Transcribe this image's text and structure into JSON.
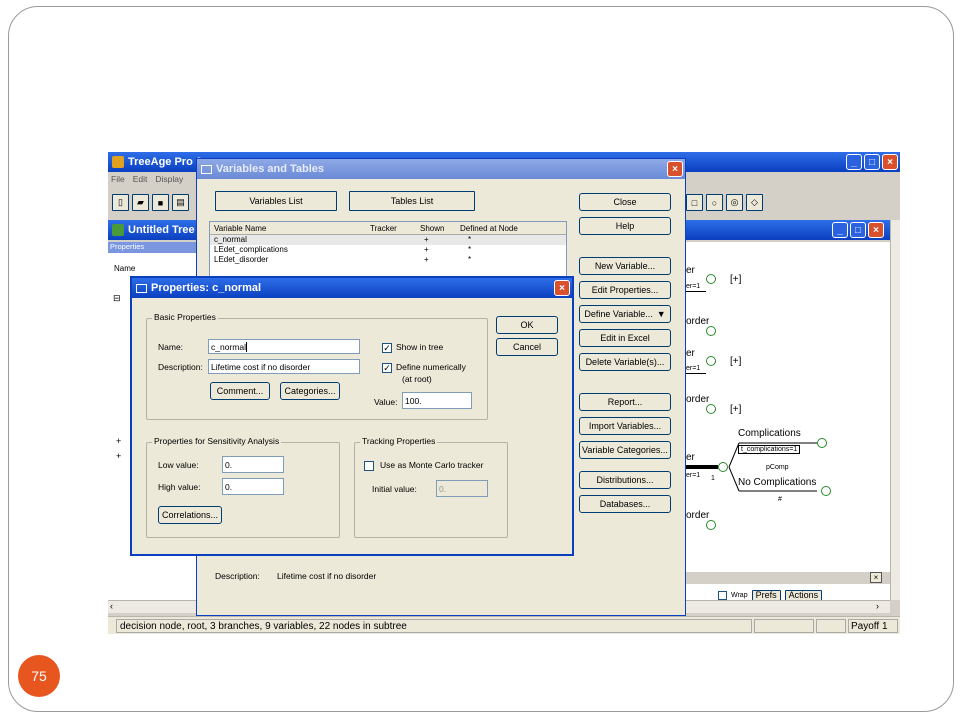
{
  "slide": {
    "page_number": "75"
  },
  "main_window": {
    "title": "TreeAge Pro 2",
    "menu": [
      "File",
      "Edit",
      "Display"
    ],
    "doc_title": "Untitled Tree",
    "properties_label": "Properties",
    "name_col": "Name",
    "status": "decision node, root, 3 branches, 9 variables, 22 nodes in subtree",
    "payoff": "Payoff 1"
  },
  "tree": {
    "labels": {
      "plus1": "[+]",
      "plus2": "[+]",
      "plus3": "[+]",
      "complications": "Complications",
      "t_complications": "t_complications=1",
      "pcomp": "pComp",
      "no_complications": "No Complications",
      "hash": "#",
      "frag_er1": "er",
      "frag_eq1": "er=1",
      "frag_order1": "order",
      "frag_er2": "er",
      "frag_eq2": "er=1",
      "frag_order2": "order",
      "frag_er3": "er",
      "frag_eq3": "er=1",
      "frag_one": "1",
      "frag_order3": "order"
    },
    "bottom_bar": {
      "wrap": "Wrap",
      "prefs": "Prefs",
      "actions": "Actions"
    }
  },
  "variables_dialog": {
    "title": "Variables and Tables",
    "tabs": [
      "Variables List",
      "Tables List"
    ],
    "columns": [
      "Variable Name",
      "Tracker",
      "Shown",
      "Defined at Node"
    ],
    "rows": [
      {
        "name": "c_normal",
        "tracker": "",
        "shown": "+",
        "defined": "*"
      },
      {
        "name": "LEdet_complications",
        "tracker": "",
        "shown": "+",
        "defined": "*"
      },
      {
        "name": "LEdet_disorder",
        "tracker": "",
        "shown": "+",
        "defined": "*"
      }
    ],
    "buttons": [
      "Close",
      "Help",
      "New Variable...",
      "Edit Properties...",
      "Define Variable...",
      "Edit in Excel",
      "Delete Variable(s)...",
      "Report...",
      "Import Variables...",
      "Variable Categories...",
      "Distributions...",
      "Databases..."
    ],
    "description_label": "Description:",
    "description_value": "Lifetime cost if no disorder"
  },
  "properties_dialog": {
    "title": "Properties: c_normal",
    "basic_group": "Basic Properties",
    "name_label": "Name:",
    "name_value": "c_normal",
    "description_label": "Description:",
    "description_value": "Lifetime cost if no disorder",
    "comment_btn": "Comment...",
    "categories_btn": "Categories...",
    "show_in_tree": "Show in tree",
    "define_numerically": "Define numerically",
    "at_root": "(at root)",
    "value_label": "Value:",
    "value_value": "100.",
    "ok_btn": "OK",
    "cancel_btn": "Cancel",
    "sens_group": "Properties for Sensitivity Analysis",
    "low_label": "Low value:",
    "low_value": "0.",
    "high_label": "High value:",
    "high_value": "0.",
    "correlations_btn": "Correlations...",
    "tracking_group": "Tracking Properties",
    "monte_carlo": "Use as Monte Carlo tracker",
    "initial_label": "Initial value:",
    "initial_value": "0."
  },
  "colors": {
    "accent": "#e8561f",
    "titlebar": "#0a3fc0",
    "dialog_bg": "#ece9d8",
    "node_green": "#2a8a2a"
  }
}
